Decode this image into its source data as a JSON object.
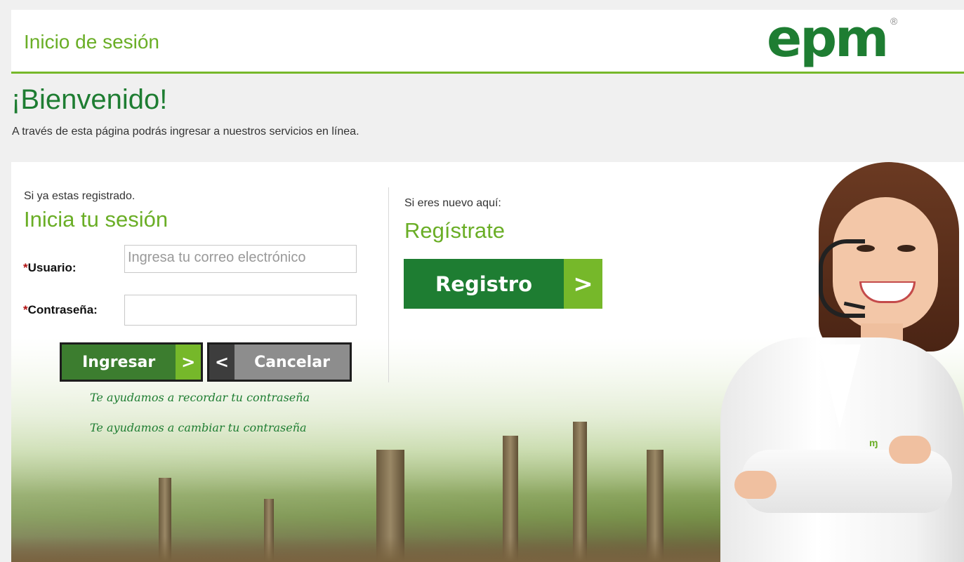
{
  "header": {
    "title": "Inicio de sesión",
    "logo_text": "epm",
    "logo_mark": "®"
  },
  "welcome": {
    "title": "¡Bienvenido!",
    "subtitle": "A través de esta página podrás ingresar a nuestros servicios en línea."
  },
  "login": {
    "pre_text": "Si ya estas registrado.",
    "title": "Inicia tu sesión",
    "user_label": "Usuario:",
    "user_placeholder": "Ingresa tu correo electrónico",
    "password_label": "Contraseña:",
    "required_mark": "*",
    "submit_label": "Ingresar",
    "cancel_label": "Cancelar",
    "forgot_link": "Te ayudamos a recordar tu contraseña",
    "change_link": "Te ayudamos a cambiar tu contraseña"
  },
  "register": {
    "pre_text": "Si eres nuevo aquí:",
    "title": "Regístrate",
    "button_label": "Registro"
  },
  "icons": {
    "submit_arrow": ">",
    "cancel_arrow": "<",
    "register_arrow": ">"
  },
  "colors": {
    "brand_green": "#1e7d32",
    "accent_green": "#76b82a",
    "title_green": "#6aae26",
    "cancel_gray": "#8d8d8d"
  },
  "images": {
    "agent": "customer-service-agent-photo",
    "background": "forest-background"
  }
}
